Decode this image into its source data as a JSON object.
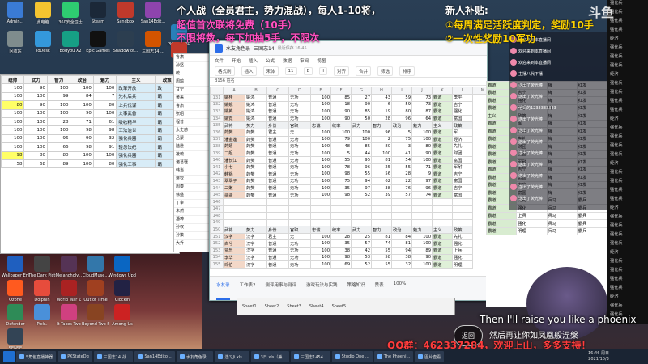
{
  "overlay": {
    "title_line1": "个人战（全员君主，势力混战），每人1-10将，",
    "title_line2": "超值首次联将免费（10手）",
    "title_line3": "不限将数，每下加抽5手，不限次",
    "bonus_head": "新人补贴:",
    "bonus_1": "①每周满足活跃度判定，奖励10手",
    "bonus_2": "②一次性奖励10军功",
    "song_en": "Then I'll raise you like a phoenix",
    "song_cn": "然后再让你如凤凰般涅槃",
    "qq_line": "QQ群：462337284，欢迎上山，多多支持！",
    "return_button": "返回",
    "logo_text": "斗鱼"
  },
  "desktop_icons": [
    {
      "label": "Admin...",
      "color": "#3a7bd5"
    },
    {
      "label": "此电脑",
      "color": "#f4c430"
    },
    {
      "label": "360安全卫士",
      "color": "#2ecc71"
    },
    {
      "label": "Steam",
      "color": "#1b2838"
    },
    {
      "label": "Sandbox",
      "color": "#c0392b"
    },
    {
      "label": "San14Edit...",
      "color": "#8e44ad"
    },
    {
      "label": "PKSD-PARC",
      "color": "#2980b9"
    },
    {
      "label": "回收站",
      "color": "#7f8c8d"
    },
    {
      "label": "ToDesk",
      "color": "#3498db"
    },
    {
      "label": "Bodyou X2",
      "color": "#16a085"
    },
    {
      "label": "Epic Games",
      "color": "#111111"
    },
    {
      "label": "Shadow of...",
      "color": "#2c3e50"
    },
    {
      "label": "三国志14 ...",
      "color": "#d35400"
    },
    {
      "label": "Boss",
      "color": "#c0392b"
    }
  ],
  "lower_icons": [
    {
      "label": "Wallpaper Engine",
      "color": "#1f5fbf"
    },
    {
      "label": "The Dark Pictures",
      "color": "#444444"
    },
    {
      "label": "Melancholy...",
      "color": "#553355"
    },
    {
      "label": "CloudMuse...",
      "color": "#3377aa"
    },
    {
      "label": "Windows Update",
      "color": "#0a66c2"
    },
    {
      "label": "Ozone",
      "color": "#ff5a1f"
    },
    {
      "label": "Dolphin",
      "color": "#e74c3c"
    },
    {
      "label": "World War Z",
      "color": "#aa2222"
    },
    {
      "label": "Out of Time",
      "color": "#a04020"
    },
    {
      "label": "ClockIn",
      "color": "#222244"
    },
    {
      "label": "Defender",
      "color": "#2e8b57"
    },
    {
      "label": "Pick..",
      "color": "#4a90d9"
    },
    {
      "label": "It Takes Two",
      "color": "#d04080"
    },
    {
      "label": "Beyond Two Souls",
      "color": "#884422"
    },
    {
      "label": "Among Us",
      "color": "#cc2222"
    },
    {
      "label": "SENSE",
      "color": "#334455"
    }
  ],
  "left_sheet": {
    "headers": [
      "统帅",
      "武力",
      "智力",
      "政治",
      "魅力",
      "主义",
      "政策"
    ],
    "rows": [
      [
        "100",
        "90",
        "100",
        "100",
        "100",
        "改革开放",
        "政"
      ],
      [
        "100",
        "100",
        "99",
        "84",
        "7",
        "先礼后兵",
        "霸"
      ],
      [
        "80",
        "90",
        "100",
        "100",
        "80",
        "上兵伐谋",
        "霸"
      ],
      [
        "100",
        "100",
        "100",
        "90",
        "100",
        "文事武备",
        "霸"
      ],
      [
        "100",
        "100",
        "28",
        "71",
        "61",
        "吸收精华",
        "霸"
      ],
      [
        "100",
        "100",
        "100",
        "98",
        "98",
        "工法治世",
        "霸"
      ],
      [
        "100",
        "100",
        "96",
        "90",
        "32",
        "强化兵器",
        "霸"
      ],
      [
        "100",
        "100",
        "66",
        "98",
        "91",
        "轻忽法纪",
        "霸"
      ],
      [
        "98",
        "80",
        "80",
        "100",
        "100",
        "强化兵器",
        "霸"
      ],
      [
        "58",
        "68",
        "89",
        "100",
        "80",
        "强化工事",
        "霸"
      ]
    ]
  },
  "main_window": {
    "app_title": "水友角色录",
    "doc_title": "三国志14",
    "doc_status": "最近保存 16:45",
    "menu": [
      "文件",
      "开始",
      "插入",
      "公式",
      "数据",
      "审阅",
      "视图"
    ],
    "toolbar": [
      "格式刷",
      "插入",
      "宋体",
      "11",
      "B",
      "I",
      "对齐",
      "合并",
      "筛选",
      "排序"
    ],
    "formula": "B156  姓名",
    "columns": [
      "",
      "A",
      "B",
      "C",
      "D",
      "E",
      "F",
      "G",
      "H",
      "I",
      "J",
      "K",
      "L",
      "M"
    ],
    "rows": [
      {
        "n": "131",
        "cells": [
          "姚桂",
          "姚鸿",
          "普通",
          "无功",
          "100",
          "85",
          "27",
          "43",
          "59",
          "73",
          "霸道",
          "李平"
        ],
        "grey": false
      },
      {
        "n": "132",
        "cells": [
          "姚娥",
          "姚鸿",
          "普通",
          "无功",
          "100",
          "18",
          "90",
          "6",
          "59",
          "73",
          "霸道",
          "吉宁"
        ],
        "grey": false
      },
      {
        "n": "133",
        "cells": [
          "姚英",
          "姚鸿",
          "普通",
          "无功",
          "100",
          "90",
          "85",
          "19",
          "80",
          "87",
          "霸道",
          "强化"
        ],
        "grey": false
      },
      {
        "n": "134",
        "cells": [
          "姚霓",
          "姚鸿",
          "普通",
          "无功",
          "100",
          "90",
          "50",
          "28",
          "96",
          "64",
          "霸道",
          "富国"
        ],
        "grey": false
      },
      {
        "n": "135",
        "cells": [
          "武将",
          "势力",
          "身份",
          "官职",
          "忠诚",
          "统率",
          "武力",
          "智力",
          "政治",
          "魅力",
          "主义",
          "政策"
        ],
        "grey": true
      },
      {
        "n": "136",
        "cells": [
          "药樊",
          "药樊",
          "君主",
          "无",
          "100",
          "100",
          "100",
          "96",
          "5",
          "100",
          "霸道",
          "军"
        ],
        "grey": false
      },
      {
        "n": "137",
        "cells": [
          "潘金莲",
          "药樊",
          "普通",
          "无功",
          "100",
          "79",
          "100",
          "2",
          "75",
          "100",
          "霸道",
          "经济"
        ],
        "grey": false
      },
      {
        "n": "138",
        "cells": [
          "药嬉",
          "药樊",
          "普通",
          "无功",
          "100",
          "48",
          "85",
          "80",
          "3",
          "80",
          "霸道",
          "先礼"
        ],
        "grey": false
      },
      {
        "n": "139",
        "cells": [
          "二姐",
          "药樊",
          "普通",
          "无功",
          "100",
          "5",
          "44",
          "100",
          "41",
          "90",
          "霸道",
          "财团"
        ],
        "grey": false
      },
      {
        "n": "140",
        "cells": [
          "潘长江",
          "药樊",
          "普通",
          "无功",
          "100",
          "55",
          "95",
          "81",
          "54",
          "100",
          "霸道",
          "富国"
        ],
        "grey": false
      },
      {
        "n": "141",
        "cells": [
          "小七",
          "药樊",
          "普通",
          "无功",
          "100",
          "78",
          "96",
          "25",
          "55",
          "71",
          "霸道",
          "军耐"
        ],
        "grey": false
      },
      {
        "n": "142",
        "cells": [
          "韩锅",
          "药樊",
          "普通",
          "无功",
          "100",
          "98",
          "55",
          "56",
          "28",
          "9",
          "霸道",
          "吉宁"
        ],
        "grey": false
      },
      {
        "n": "143",
        "cells": [
          "翠翠子",
          "药樊",
          "普通",
          "无功",
          "100",
          "75",
          "94",
          "62",
          "22",
          "97",
          "霸道",
          "富国"
        ],
        "grey": false
      },
      {
        "n": "144",
        "cells": [
          "二嫩",
          "药樊",
          "普通",
          "无功",
          "100",
          "35",
          "97",
          "38",
          "76",
          "96",
          "霸道",
          "吉宁"
        ],
        "grey": false
      },
      {
        "n": "145",
        "cells": [
          "翡翡",
          "药樊",
          "普通",
          "无功",
          "100",
          "98",
          "52",
          "39",
          "57",
          "74",
          "霸道",
          "富国"
        ],
        "grey": false
      },
      {
        "n": "146",
        "cells": [
          "",
          "",
          "",
          "",
          "",
          "",
          "",
          "",
          "",
          "",
          "",
          ""
        ],
        "grey": false
      },
      {
        "n": "147",
        "cells": [
          "",
          "",
          "",
          "",
          "",
          "",
          "",
          "",
          "",
          "",
          "",
          ""
        ],
        "grey": false
      },
      {
        "n": "148",
        "cells": [
          "",
          "",
          "",
          "",
          "",
          "",
          "",
          "",
          "",
          "",
          "",
          ""
        ],
        "grey": false
      },
      {
        "n": "149",
        "cells": [
          "",
          "",
          "",
          "",
          "",
          "",
          "",
          "",
          "",
          "",
          "",
          ""
        ],
        "grey": false
      },
      {
        "n": "150",
        "cells": [
          "武将",
          "势力",
          "身份",
          "官职",
          "忠诚",
          "统率",
          "武力",
          "智力",
          "政治",
          "魅力",
          "主义",
          "政策"
        ],
        "grey": true
      },
      {
        "n": "151",
        "cells": [
          "汉字",
          "汉字",
          "君主",
          "无",
          "100",
          "28",
          "25",
          "81",
          "84",
          "100",
          "霸道",
          "先礼"
        ],
        "grey": false
      },
      {
        "n": "152",
        "cells": [
          "白兮",
          "汉字",
          "普通",
          "无功",
          "100",
          "35",
          "57",
          "74",
          "81",
          "100",
          "霸道",
          "强化"
        ],
        "grey": false
      },
      {
        "n": "153",
        "cells": [
          "贾乐",
          "汉字",
          "普通",
          "无功",
          "100",
          "38",
          "42",
          "55",
          "94",
          "89",
          "霸道",
          "上兵"
        ],
        "grey": false
      },
      {
        "n": "154",
        "cells": [
          "李华",
          "汉字",
          "普通",
          "无功",
          "100",
          "98",
          "53",
          "58",
          "38",
          "90",
          "霸道",
          "强化"
        ],
        "grey": false
      },
      {
        "n": "155",
        "cells": [
          "邓伯",
          "汉字",
          "普通",
          "无功",
          "100",
          "69",
          "52",
          "55",
          "32",
          "100",
          "霸道",
          "明理"
        ],
        " grey": false
      }
    ],
    "sheet_tabs": [
      "水友录",
      "工作表2",
      "测评用事与测评",
      "游戏玩法与实践",
      "策略知识",
      "赞表"
    ],
    "active_tab": 0,
    "zoom": "100%"
  },
  "side_col": [
    "鲁肃",
    "孙坚",
    "统",
    "周瑜",
    "甘宁",
    "黄盖",
    "鲁肃",
    "张昭",
    "程普",
    "太史慈",
    "吕蒙",
    "陆逊",
    "凌统",
    "诸葛瑾",
    "韩当",
    "蒋钦",
    "周泰",
    "徐盛",
    "丁奉",
    "朱然",
    "潘璋",
    "孙权",
    "孙策",
    "大乔"
  ],
  "right_list": [
    [
      "霸道",
      "李平",
      "梅",
      "红发"
    ],
    [
      "霸道",
      "吉宁",
      "梅",
      "红发"
    ],
    [
      "霸道",
      "强化",
      "梅",
      "红发"
    ],
    [
      "霸道",
      "富国",
      "梅",
      "红发"
    ],
    [
      "主义",
      "政策",
      "梅",
      "红发"
    ],
    [
      "霸道",
      "军",
      "梅",
      "红发"
    ],
    [
      "霸道",
      "经济",
      "梅",
      "红发"
    ],
    [
      "霸道",
      "先礼",
      "梅",
      "红发"
    ],
    [
      "霸道",
      "财团",
      "梅",
      "红发"
    ],
    [
      "霸道",
      "富国",
      "梅",
      "红发"
    ],
    [
      "霸道",
      "军耐",
      "梅",
      "红发"
    ],
    [
      "霸道",
      "吉宁",
      "梅",
      "红发"
    ],
    [
      "霸道",
      "富国",
      "梅",
      "红发"
    ],
    [
      "霸道",
      "吉宁",
      "梅",
      "红发"
    ],
    [
      "霸道",
      "富国",
      "梅",
      "红发"
    ],
    [
      "霸道",
      "先礼",
      "兵马",
      "霸兵"
    ],
    [
      "霸道",
      "强化",
      "兵马",
      "霸兵"
    ],
    [
      "霸道",
      "上兵",
      "兵马",
      "霸兵"
    ],
    [
      "霸道",
      "强化",
      "兵马",
      "霸兵"
    ],
    [
      "霸道",
      "明理",
      "兵马",
      "霸兵"
    ]
  ],
  "far_right": [
    "强化兵",
    "强化兵",
    "强化兵",
    "强化兵",
    "经济",
    "强化兵",
    "强化兵",
    "强化兵",
    "经济",
    "强化兵",
    "强化兵",
    "强化兵",
    "强化兵",
    "经济",
    "强化兵",
    "强化兵",
    "强化兵",
    "强化兵",
    "经济",
    "强化兵",
    "强化兵",
    "强化兵",
    "强化兵",
    "经济",
    "强化兵",
    "强化兵",
    "强化兵",
    "强化兵",
    "经济",
    "强化兵",
    "强化兵",
    "强化兵",
    "强化兵",
    "经济",
    "强化兵",
    "强化兵"
  ],
  "chat": [
    "欢迎来到本直播间",
    "欢迎来到本直播间",
    "欢迎来到本直播间",
    "主播八代下播",
    "送出了荧光棒",
    "送出了荧光棒",
    "他妈的1233333333",
    "送出了荧光棒",
    "送出了荧光棒",
    "送出了荧光棒",
    "送出了荧光棒",
    "送出了荧光棒",
    "送出了荧光棒",
    "送出了荧光棒",
    "送出了荧光棒"
  ],
  "excel2": {
    "tabs": [
      "Sheet1",
      "Sheet2",
      "Sheet3",
      "Sheet4",
      "Sheet5"
    ]
  },
  "taskbar": [
    "5角色直播神器",
    "PKStateDg",
    "三国志14 战...",
    "San14Edito...",
    "水友角色录...",
    "选习Ji.xls...",
    "3日.xls（兼...",
    "三国志1454...",
    "Studio One ...",
    "The Phoeni...",
    "图片查看"
  ],
  "clock": {
    "time": "16:46 周日",
    "date": "2021/10/3"
  }
}
